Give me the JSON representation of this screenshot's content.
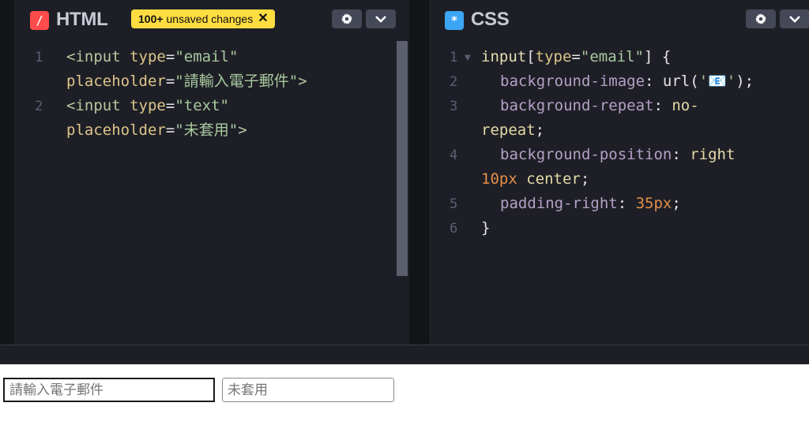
{
  "html_pane": {
    "badge": "/",
    "title": "HTML",
    "unsaved": {
      "count": "100+",
      "text": "unsaved changes",
      "close": "✕"
    },
    "line_numbers": [
      "1",
      "2"
    ],
    "code": {
      "l1a_tag": "<input",
      "l1a_attr": "type",
      "l1a_eq": "=",
      "l1a_str": "\"email\"",
      "l1b_attr": "placeholder",
      "l1b_eq": "=",
      "l1b_str": "\"請輸入電子郵件\"",
      "l1b_close": ">",
      "l2a_tag": "<input",
      "l2a_attr": "type",
      "l2a_eq": "=",
      "l2a_str": "\"text\"",
      "l2b_attr": "placeholder",
      "l2b_eq": "=",
      "l2b_str": "\"未套用\"",
      "l2b_close": ">"
    }
  },
  "css_pane": {
    "badge": "*",
    "title": "CSS",
    "line_numbers": [
      "1",
      "2",
      "3",
      "4",
      "5",
      "6"
    ],
    "code": {
      "l1_sel": "input",
      "l1_bracket_open": "[",
      "l1_attr": "type",
      "l1_eq": "=",
      "l1_str": "\"email\"",
      "l1_bracket_close": "]",
      "l1_brace": " {",
      "l2_prop": "background-image",
      "l2_colon": ": ",
      "l2_fn": "url(",
      "l2_str": "'📧'",
      "l2_end": ");",
      "l3_prop": "background-repeat",
      "l3_colon": ": ",
      "l3_val": "no-",
      "l3b_val": "repeat",
      "l3b_end": ";",
      "l4_prop": "background-position",
      "l4_colon": ": ",
      "l4_val": "right",
      "l4b_num": "10px",
      "l4b_val": " center",
      "l4b_end": ";",
      "l5_prop": "padding-right",
      "l5_colon": ": ",
      "l5_num": "35px",
      "l5_end": ";",
      "l6_brace": "}"
    }
  },
  "preview": {
    "email_placeholder": "請輸入電子郵件",
    "text_placeholder": "未套用"
  },
  "colors": {
    "html_badge": "#ff4b4b",
    "css_badge": "#3ca6f5",
    "unsaved_badge": "#ffdd40"
  },
  "icons": [
    "gear-icon",
    "chevron-down-icon",
    "close-icon"
  ]
}
